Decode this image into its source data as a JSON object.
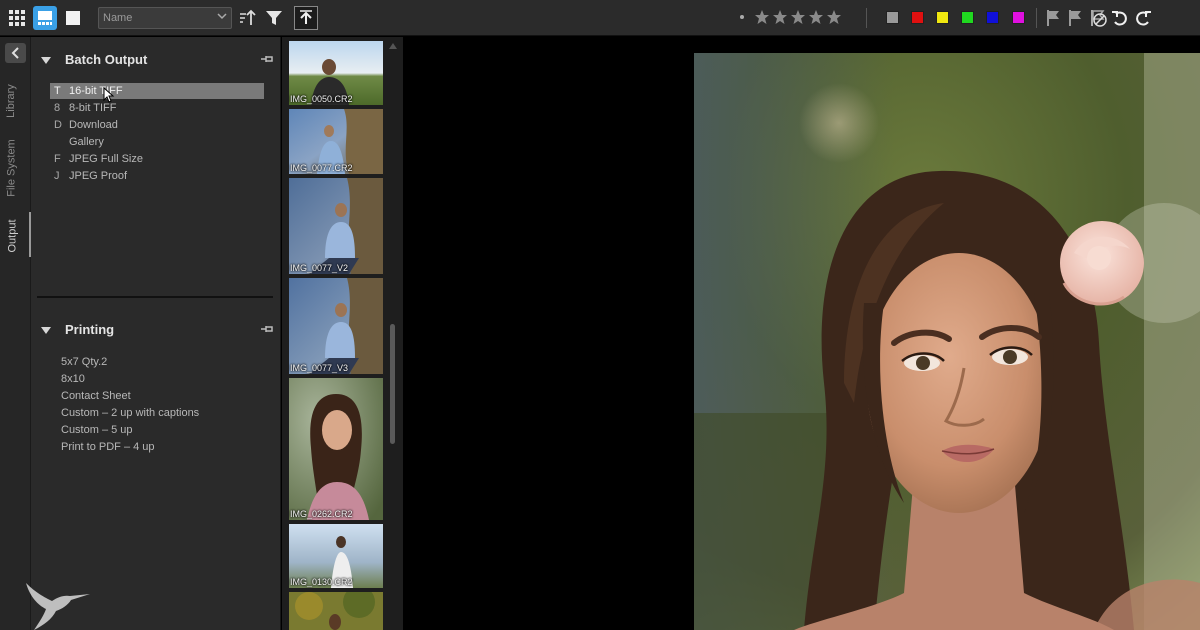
{
  "toolbar": {
    "sort_by": "Name",
    "rating_stars": 5,
    "color_labels": [
      "#9a9a9a",
      "#e01010",
      "#f0e810",
      "#20d820",
      "#1010d8",
      "#e010e0"
    ]
  },
  "tabs": [
    {
      "label": "Library"
    },
    {
      "label": "File System"
    },
    {
      "label": "Output"
    }
  ],
  "batch_output": {
    "title": "Batch Output",
    "recipes": [
      {
        "key": "T",
        "label": "16-bit TIFF",
        "selected": true
      },
      {
        "key": "8",
        "label": "8-bit TIFF"
      },
      {
        "key": "D",
        "label": "Download"
      },
      {
        "key": "",
        "label": "Gallery"
      },
      {
        "key": "F",
        "label": "JPEG Full Size"
      },
      {
        "key": "J",
        "label": "JPEG Proof"
      }
    ]
  },
  "printing": {
    "title": "Printing",
    "items": [
      "5x7 Qty.2",
      "8x10",
      "Contact Sheet",
      "Custom – 2 up with captions",
      "Custom – 5 up",
      "Print to PDF – 4 up"
    ]
  },
  "thumbnails": [
    {
      "label": "IMG_0050.CR2"
    },
    {
      "label": "IMG_0077.CR2"
    },
    {
      "label": "IMG_0077_V2"
    },
    {
      "label": "IMG_0077_V3"
    },
    {
      "label": "IMG_0262.CR2"
    },
    {
      "label": "IMG_0130.CR2"
    },
    {
      "label": ""
    }
  ],
  "colors": {
    "accent": "#3aa0e6",
    "panel": "#2a2a2a",
    "selected_row": "#7a7a7a"
  }
}
